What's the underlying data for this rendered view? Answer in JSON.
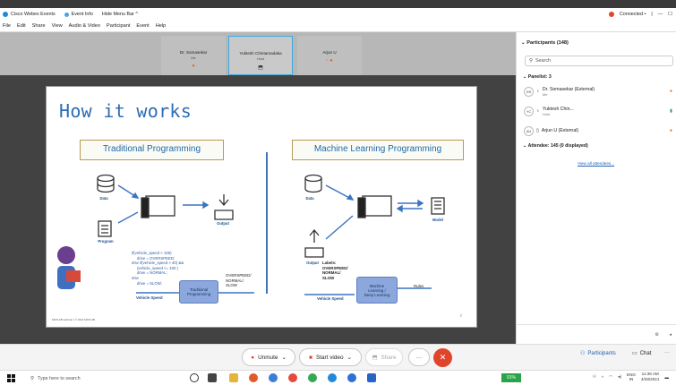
{
  "window": {
    "app_name": "Cisco Webex Events",
    "event_info": "Event Info",
    "hide_menu": "Hide Menu Bar ^",
    "status": "Connected •",
    "controls": [
      "|",
      "—",
      "☐"
    ]
  },
  "menu": [
    "File",
    "Edit",
    "Share",
    "View",
    "Audio & Video",
    "Participant",
    "Event",
    "Help"
  ],
  "panelists_strip": [
    {
      "name": "Dr. Somasekar",
      "role": "Me"
    },
    {
      "name": "Yuktesh Chintamadaka",
      "role": "Host"
    },
    {
      "name": "Arjun U",
      "role": ""
    }
  ],
  "slide": {
    "title": "How it works",
    "traditional": "Traditional  Programming",
    "ml": "Machine Learning  Programming",
    "labels": {
      "data": "Data",
      "program": "Program",
      "output": "Output",
      "data2": "Data",
      "output2": "Output",
      "model": "Model"
    },
    "code": "if(vehicle_speed > 100)\n     drive = OVERSPEED;\nelse if(vehicle_speed > 40) &&\n     (vehicle_speed <= 100 )\n     drive = NORMAL;\nelse\n     drive = SLOW;",
    "vehicle_speed": "Vehicle Speed",
    "trad_box": "Traditional\nProgramming",
    "outputs": "OVERSPEED/\nNORMAL/\nSLOW",
    "ml_labels": "Labels:\nOVERSPEED/\nNORMAL/\nSLOW",
    "vehicle_speed2": "Vehicle Speed",
    "ml_box": "Machine\nLearning /\nDeep Learning",
    "rules": "Rules",
    "footer": "MATLAB webinar | © 2021 MATLAB",
    "page": "7"
  },
  "controls": {
    "unmute": "Unmute",
    "start_video": "Start video",
    "share": "Share",
    "more": "···",
    "participants": "Participants",
    "chat": "Chat",
    "overflow": "···"
  },
  "panel": {
    "header": "Participants (148)",
    "search_placeholder": "Search",
    "panelist_header": "Panelist: 3",
    "people": [
      {
        "initials": "DS",
        "name": "Dr. Somasekar (External)",
        "role": "Me"
      },
      {
        "initials": "YC",
        "name": "Yuktesh Chin...",
        "role": "Host"
      },
      {
        "initials": "AU",
        "name": "Arjun U (External)",
        "role": ""
      }
    ],
    "attendee_header": "Attendee: 145 (0 displayed)",
    "view_all": "View all attendees..."
  },
  "taskbar": {
    "search": "Type here to search",
    "battery": "91%",
    "lang": "ENG\nIN",
    "time": "11:36 AM",
    "date": "4/28/2021"
  }
}
